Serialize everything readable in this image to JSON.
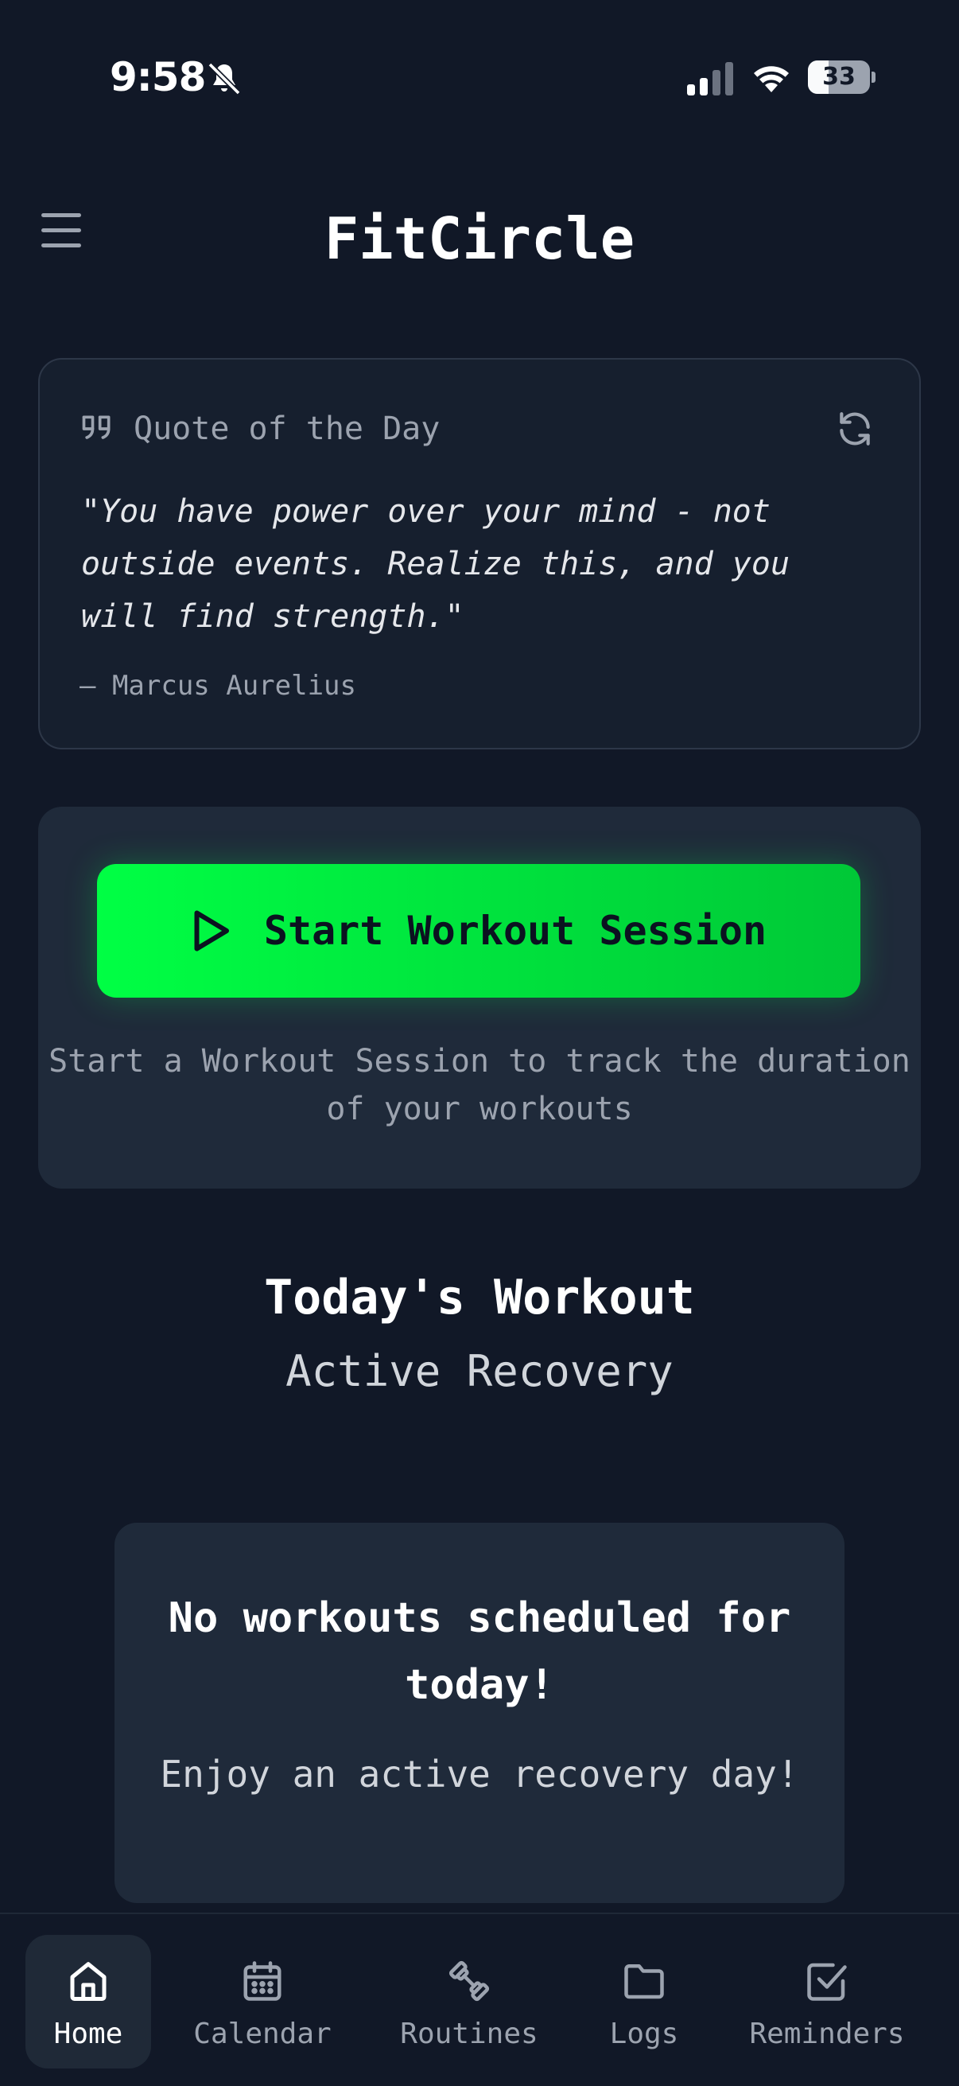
{
  "status_bar": {
    "time": "9:58",
    "battery_level": 33,
    "battery_text": "33",
    "icons": [
      "bell-slash-icon",
      "signal-icon",
      "wifi-icon",
      "battery-icon"
    ]
  },
  "header": {
    "app_title": "FitCircle",
    "menu_icon": "hamburger-menu-icon"
  },
  "quote_card": {
    "title": "Quote of the Day",
    "text": "\"You have power over your mind - not outside events. Realize this, and you will find strength.\"",
    "author": "— Marcus Aurelius",
    "icons": [
      "quote-icon",
      "refresh-icon"
    ]
  },
  "session_card": {
    "button_label": "Start Workout Session",
    "description": "Start a Workout Session to track the duration of your workouts",
    "button_color": "#00ff44"
  },
  "today": {
    "title": "Today's Workout",
    "subtitle": "Active Recovery",
    "empty_title": "No workouts scheduled for today!",
    "empty_subtitle": "Enjoy an active recovery day!"
  },
  "bottom_nav": {
    "items": [
      {
        "label": "Home",
        "icon": "home-icon",
        "active": true
      },
      {
        "label": "Calendar",
        "icon": "calendar-icon",
        "active": false
      },
      {
        "label": "Routines",
        "icon": "dumbbell-icon",
        "active": false
      },
      {
        "label": "Logs",
        "icon": "folder-icon",
        "active": false
      },
      {
        "label": "Reminders",
        "icon": "checkbox-icon",
        "active": false
      }
    ]
  },
  "colors": {
    "background": "#111827",
    "card": "#1f2a3a",
    "accent": "#00ff44",
    "muted_text": "#9ca3af"
  }
}
